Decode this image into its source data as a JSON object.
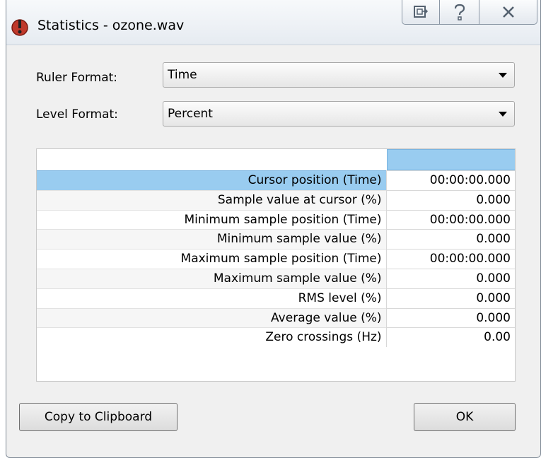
{
  "window": {
    "title": "Statistics - ozone.wav"
  },
  "controls": {
    "ruler_format_label": "Ruler Format:",
    "ruler_format_value": "Time",
    "level_format_label": "Level Format:",
    "level_format_value": "Percent"
  },
  "table": {
    "rows": [
      {
        "name": "Cursor position (Time)",
        "value": "00:00:00.000"
      },
      {
        "name": "Sample value at cursor (%)",
        "value": "0.000"
      },
      {
        "name": "Minimum sample position (Time)",
        "value": "00:00:00.000"
      },
      {
        "name": "Minimum sample value (%)",
        "value": "0.000"
      },
      {
        "name": "Maximum sample position (Time)",
        "value": "00:00:00.000"
      },
      {
        "name": "Maximum sample value (%)",
        "value": "0.000"
      },
      {
        "name": "RMS level (%)",
        "value": "0.000"
      },
      {
        "name": "Average value (%)",
        "value": "0.000"
      },
      {
        "name": "Zero crossings (Hz)",
        "value": "0.00"
      }
    ]
  },
  "buttons": {
    "copy_label": "Copy to Clipboard",
    "ok_label": "OK"
  },
  "colors": {
    "selection": "#99ccf0",
    "accent_icon": "#c0392b"
  },
  "icons": {
    "app": "audio-app-icon",
    "titlebar_1": "restore-window-icon",
    "titlebar_2": "help-icon",
    "titlebar_3": "close-icon"
  }
}
